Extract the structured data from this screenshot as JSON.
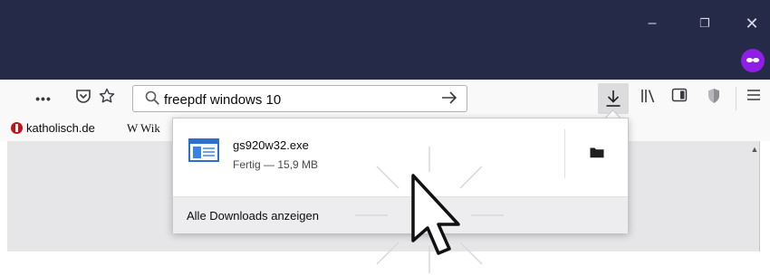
{
  "window": {
    "minimize_glyph": "–",
    "maximize_glyph": "❐",
    "close_glyph": "✕"
  },
  "toolbar": {
    "more_glyph": "•••",
    "pocket_icon": "pocket-icon",
    "bookmark_icon": "star-icon",
    "urlbar": {
      "value": "freepdf windows 10"
    },
    "download_icon": "download-arrow-icon",
    "library_icon": "library-icon",
    "sidebar_icon": "sidebar-icon",
    "shield_icon": "shield-icon",
    "menu_icon": "hamburger-menu-icon"
  },
  "bookmarks": {
    "items": [
      {
        "label": "katholisch.de"
      },
      {
        "label": "W Wik"
      }
    ]
  },
  "downloads_panel": {
    "item": {
      "filename": "gs920w32.exe",
      "status": "Fertig — 15,9 MB"
    },
    "footer_label": "Alle Downloads anzeigen"
  },
  "colors": {
    "titlebar": "#252a48",
    "private_badge": "#8f1ee6",
    "file_icon_blue": "#2d6fcf"
  }
}
